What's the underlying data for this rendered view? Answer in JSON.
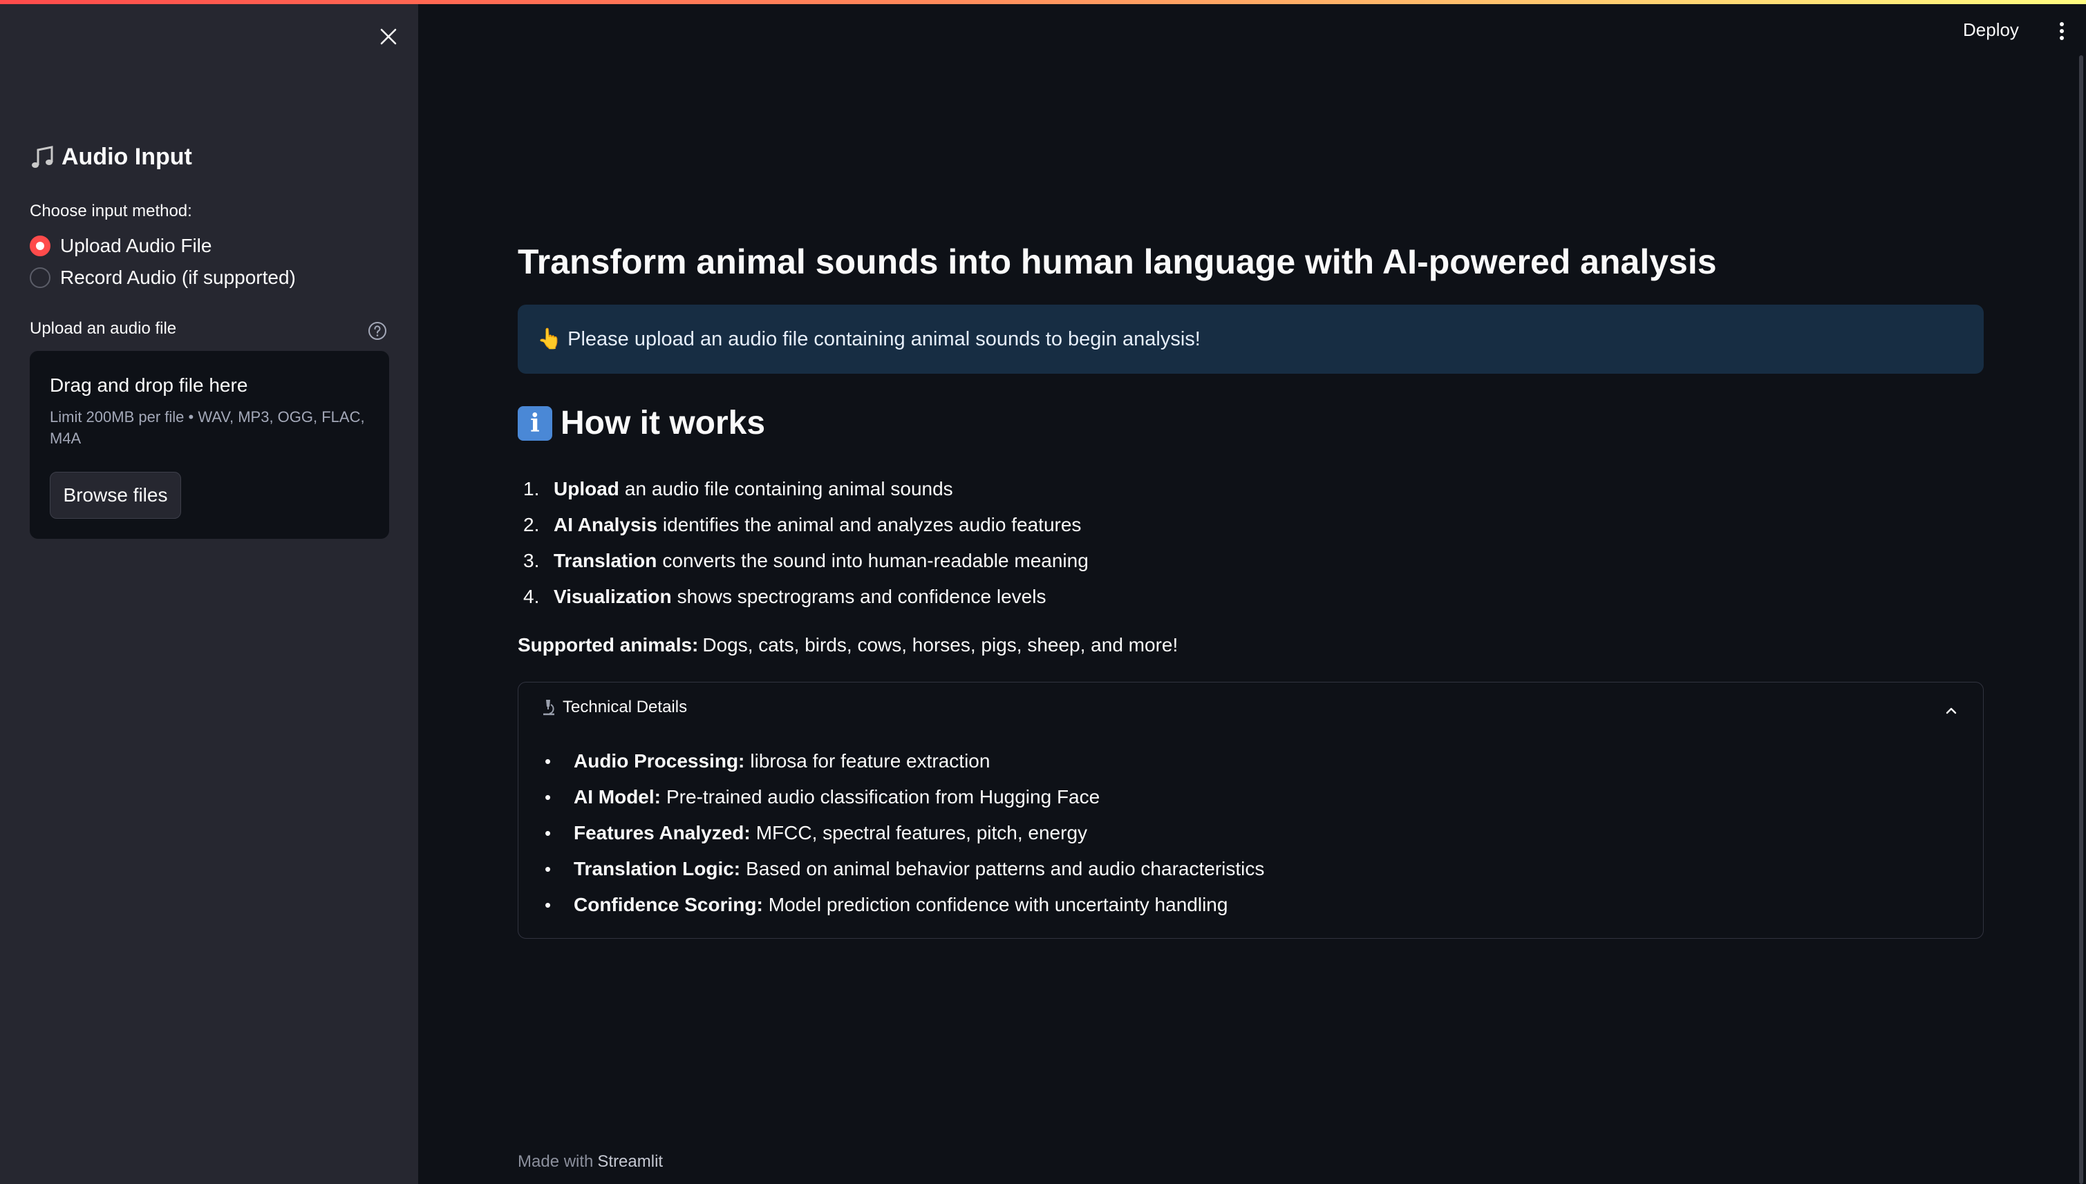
{
  "sidebar": {
    "title": "Audio Input",
    "title_icon": "musical-note",
    "input_method_label": "Choose input method:",
    "radio_options": [
      {
        "label": "Upload Audio File",
        "selected": true
      },
      {
        "label": "Record Audio (if supported)",
        "selected": false
      }
    ],
    "upload_label": "Upload an audio file",
    "dropzone": {
      "title": "Drag and drop file here",
      "subtitle": "Limit 200MB per file • WAV, MP3, OGG, FLAC, M4A",
      "browse_label": "Browse files"
    }
  },
  "header": {
    "deploy_label": "Deploy"
  },
  "main": {
    "title": "Transform animal sounds into human language with AI-powered analysis",
    "info_icon": "👆",
    "info_text": "Please upload an audio file containing animal sounds to begin analysis!",
    "how_title": "How it works",
    "how_icon": "i",
    "steps": [
      {
        "num": "1.",
        "bold": "Upload",
        "text": "an audio file containing animal sounds"
      },
      {
        "num": "2.",
        "bold": "AI Analysis",
        "text": "identifies the animal and analyzes audio features"
      },
      {
        "num": "3.",
        "bold": "Translation",
        "text": "converts the sound into human-readable meaning"
      },
      {
        "num": "4.",
        "bold": "Visualization",
        "text": "shows spectrograms and confidence levels"
      }
    ],
    "supported_label": "Supported animals:",
    "supported_text": "Dogs, cats, birds, cows, horses, pigs, sheep, and more!",
    "expander": {
      "title": "Technical Details",
      "icon": "🔬",
      "expanded": true,
      "items": [
        {
          "bold": "Audio Processing:",
          "text": "librosa for feature extraction"
        },
        {
          "bold": "AI Model:",
          "text": "Pre-trained audio classification from Hugging Face"
        },
        {
          "bold": "Features Analyzed:",
          "text": "MFCC, spectral features, pitch, energy"
        },
        {
          "bold": "Translation Logic:",
          "text": "Based on animal behavior patterns and audio characteristics"
        },
        {
          "bold": "Confidence Scoring:",
          "text": "Model prediction confidence with uncertainty handling"
        }
      ]
    }
  },
  "footer": {
    "prefix": "Made with",
    "brand": "Streamlit"
  },
  "colors": {
    "accent": "#ff4b4b",
    "background": "#0e1117",
    "sidebar": "#262730",
    "info_bg": "#172d43"
  }
}
